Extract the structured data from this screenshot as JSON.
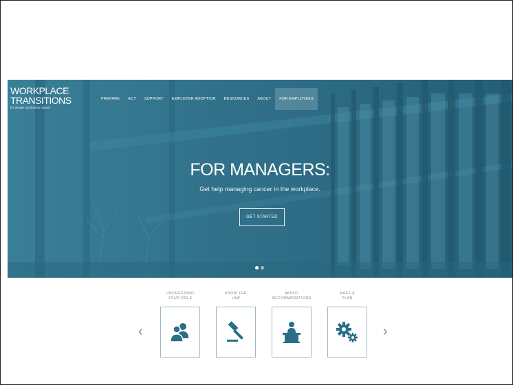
{
  "logo": {
    "line1": "WORKPLACE",
    "line2": "TRANSITIONS",
    "tagline": "for people touched by cancer"
  },
  "nav": {
    "items": [
      {
        "label": "PREPARE"
      },
      {
        "label": "ACT"
      },
      {
        "label": "SUPPORT"
      },
      {
        "label": "EMPLOYER ADOPTION"
      },
      {
        "label": "RESOURCES"
      },
      {
        "label": "ABOUT"
      },
      {
        "label": "FOR EMPLOYEES",
        "active": true
      }
    ]
  },
  "hero": {
    "headline": "FOR MANAGERS:",
    "subheadline": "Get help managing cancer in the workplace.",
    "cta": "GET STARTED",
    "slides": 2,
    "active_slide": 1
  },
  "cards": [
    {
      "line1": "UNDERSTAND",
      "line2": "YOUR ROLE",
      "icon": "people-icon"
    },
    {
      "line1": "KNOW THE",
      "line2": "LAW",
      "icon": "gavel-icon"
    },
    {
      "line1": "ABOUT",
      "line2": "ACCOMMODATIONS",
      "icon": "desk-worker-icon"
    },
    {
      "line1": "MAKE A",
      "line2": "PLAN",
      "icon": "gears-icon"
    }
  ],
  "carousel": {
    "prev": "‹",
    "next": "›"
  },
  "colors": {
    "hero": "#2f6f87",
    "icon": "#2a6e8a",
    "card_border": "#9fb7c2"
  }
}
